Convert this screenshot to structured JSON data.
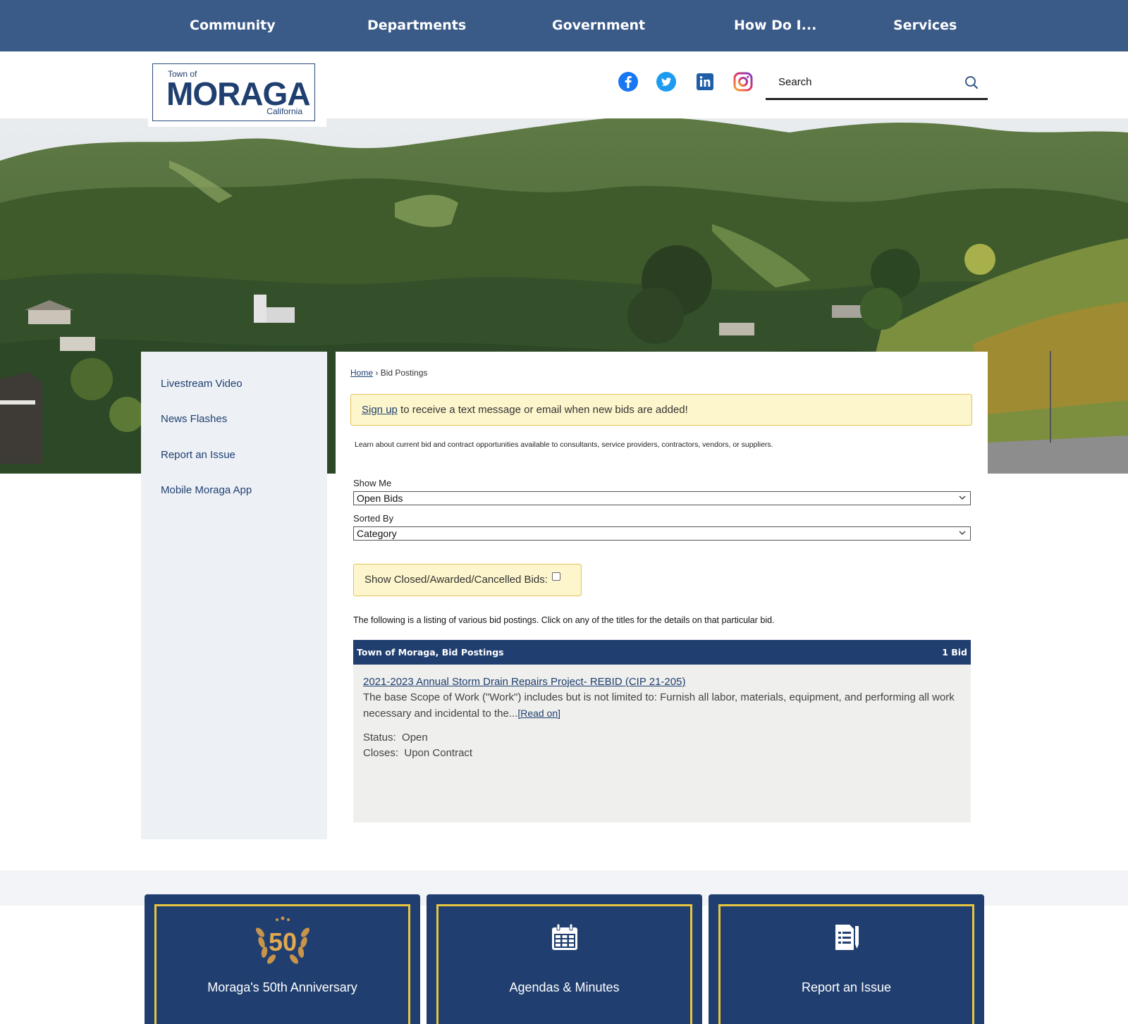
{
  "topnav": {
    "items": [
      "Community",
      "Departments",
      "Government",
      "How Do I...",
      "Services"
    ]
  },
  "logo": {
    "town": "Town of",
    "name": "MORAGA",
    "state": "California"
  },
  "search": {
    "placeholder": "Search"
  },
  "sidebar": {
    "items": [
      "Livestream Video",
      "News Flashes",
      "Report an Issue",
      "Mobile Moraga App"
    ]
  },
  "breadcrumb": {
    "home": "Home",
    "separator": "›",
    "current": "Bid Postings"
  },
  "alert": {
    "link": "Sign up",
    "text": " to receive a text message or email when new bids are added!"
  },
  "intro": "Learn about current bid and contract opportunities available to consultants, service providers, contractors, vendors, or suppliers.",
  "filters": {
    "show_me_label": "Show Me",
    "show_me_value": "Open Bids",
    "sorted_by_label": "Sorted By",
    "sorted_by_value": "Category",
    "closed_label": "Show Closed/Awarded/Cancelled Bids:"
  },
  "listing_text": "The following is a listing of various bid postings. Click on any of the titles for the details on that particular bid.",
  "bids": {
    "header": "Town of Moraga, Bid Postings",
    "count": "1 Bid",
    "items": [
      {
        "title": "2021-2023 Annual Storm Drain Repairs Project- REBID (CIP 21-205)",
        "description": "The base Scope of Work (\"Work\") includes but is not limited to: Furnish all labor, materials, equipment, and performing all work necessary and incidental to the...",
        "read_on": "[Read on]",
        "status_label": "Status:",
        "status": "Open",
        "closes_label": "Closes:",
        "closes": "Upon Contract"
      }
    ]
  },
  "tiles": [
    {
      "label": "Moraga's 50th Anniversary",
      "badge": "50"
    },
    {
      "label": "Agendas & Minutes"
    },
    {
      "label": "Report an Issue"
    }
  ],
  "colors": {
    "nav_bg": "#3a5a88",
    "brand_navy": "#203f70",
    "alert_bg": "#fdf6cc",
    "tile_border": "#e8c53d"
  }
}
